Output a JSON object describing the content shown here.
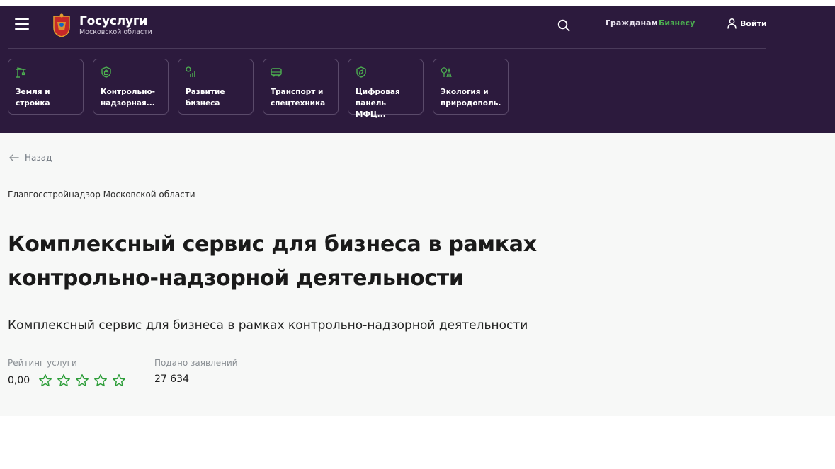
{
  "header": {
    "logo_title": "Госуслуги",
    "logo_subtitle": "Московской области",
    "nav": {
      "citizens": "Гражданам",
      "business": "Бизнесу"
    },
    "login_label": "Войти",
    "colors": {
      "background": "#2c1a3d",
      "accent": "#4caf50"
    }
  },
  "categories": [
    {
      "icon": "crane-icon",
      "label": "Земля и\nстройка"
    },
    {
      "icon": "shield-lock-icon",
      "label": "Контрольно-\nнадзорная..."
    },
    {
      "icon": "growth-chart-icon",
      "label": "Развитие\nбизнеса"
    },
    {
      "icon": "bus-icon",
      "label": "Транспорт и\nспецтехника"
    },
    {
      "icon": "leaf-shield-icon",
      "label": "Цифровая\nпанель МФЦ..."
    },
    {
      "icon": "trees-icon",
      "label": "Экология и\nприродополь..."
    }
  ],
  "page": {
    "back_label": "Назад",
    "organization": "Главгосстройнадзор Московской области",
    "title": "Комплексный сервис для бизнеса в рамках контрольно-надзорной деятельности",
    "subtitle": "Комплексный сервис для бизнеса в рамках контрольно-надзорной деятельности"
  },
  "stats": {
    "rating_label": "Рейтинг услуги",
    "rating_value": "0,00",
    "rating_stars_filled": 0,
    "rating_stars_total": 5,
    "applications_label": "Подано заявлений",
    "applications_value": "27 634"
  }
}
